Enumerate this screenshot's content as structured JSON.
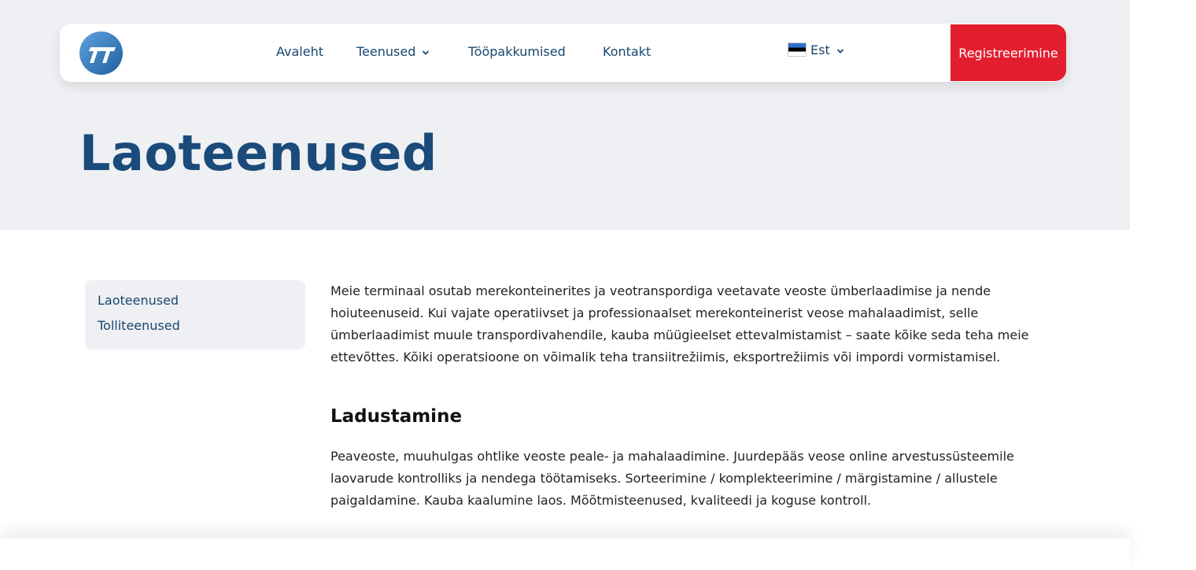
{
  "nav": {
    "items": [
      {
        "label": "Avaleht"
      },
      {
        "label": "Teenused"
      },
      {
        "label": "Tööpakkumised"
      },
      {
        "label": "Kontakt"
      }
    ],
    "language": "Est",
    "register_label": "Registreerimine"
  },
  "hero": {
    "title": "Laoteenused"
  },
  "sidebar": {
    "items": [
      {
        "label": "Laoteenused"
      },
      {
        "label": "Tolliteenused"
      }
    ]
  },
  "content": {
    "intro": "Meie terminaal osutab merekonteinerites ja veotranspordiga veetavate veoste ümberlaadimise ja nende hoiuteenuseid. Kui vajate operatiivset ja professionaalset merekonteinerist veose mahalaadimist, selle ümberlaadimist muule transpordivahendile, kauba müügieelset ettevalmistamist – saate kõike seda teha meie ettevõttes. Kõiki operatsioone on võimalik teha transiitrežiimis, eksportrežiimis või impordi vormistamisel.",
    "section_title": "Ladustamine",
    "section_text": "Peaveoste, muuhulgas  ohtlike veoste peale- ja mahalaadimine. Juurdepääs veose online arvestussüsteemile laovarude kontrolliks ja nendega töötamiseks. Sorteerimine / komplekteerimine / märgistamine / allustele paigaldamine. Kauba kaalumine laos. Mõõtmisteenused, kvaliteedi ja koguse kontroll."
  },
  "colors": {
    "accent": "#e31f2f",
    "brand_blue": "#1a4b7a",
    "hero_bg": "#eff0f3"
  }
}
